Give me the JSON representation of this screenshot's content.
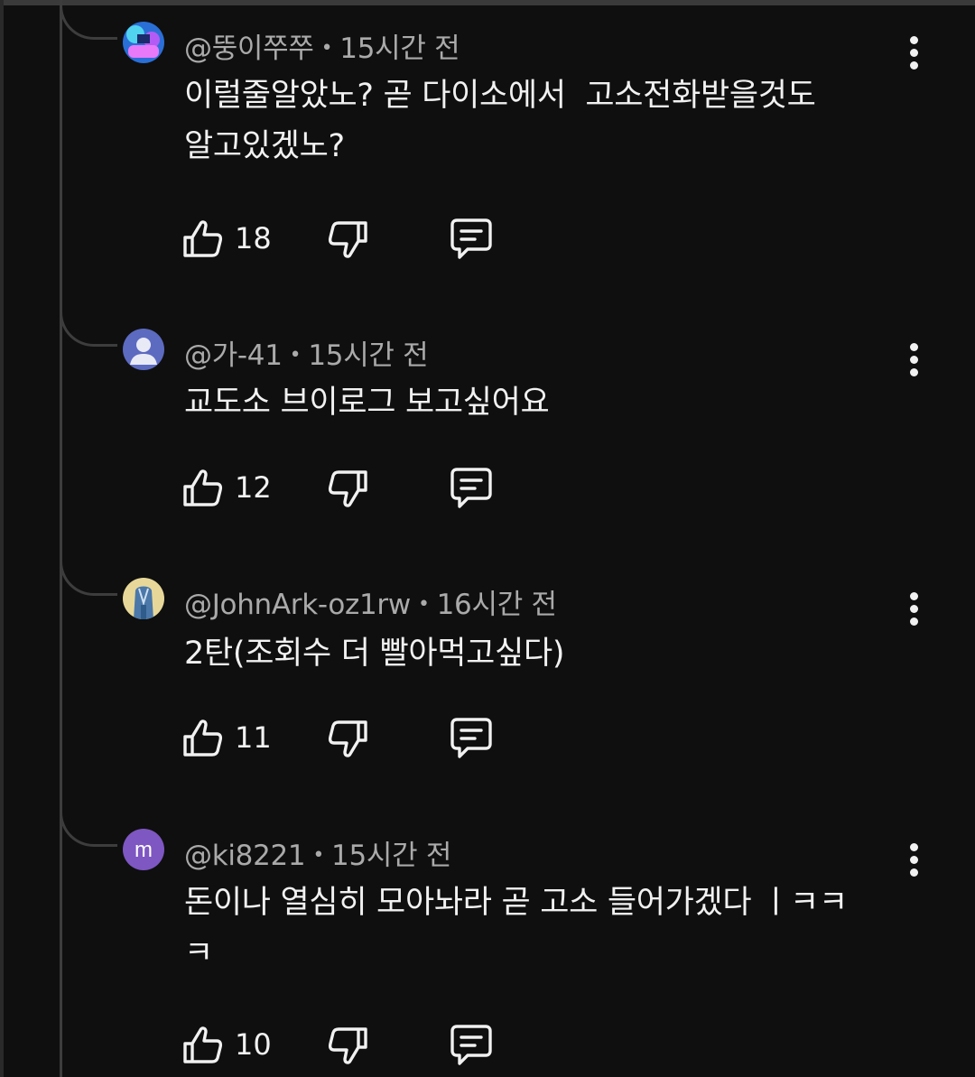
{
  "comments": [
    {
      "author": "@뚱이쭈쭈",
      "time": "15시간 전",
      "text": "이럴줄알았노? 곧 다이소에서  고소전화받을것도\n알고있겠노?",
      "likes": "18",
      "avatar": "image-avatar"
    },
    {
      "author": "@가-41",
      "time": "15시간 전",
      "text": "교도소 브이로그 보고싶어요",
      "likes": "12",
      "avatar": "default-user-avatar"
    },
    {
      "author": "@JohnArk-oz1rw",
      "time": "16시간 전",
      "text": "2탄(조회수 더 빨아먹고싶다)",
      "likes": "11",
      "avatar": "image-avatar"
    },
    {
      "author": "@ki8221",
      "time": "15시간 전",
      "text": "돈이나 열심히 모아놔라 곧 고소 들어가겠다 ㅣㅋㅋ\nㅋ",
      "likes": "10",
      "avatar_letter": "m"
    }
  ],
  "meta_separator": "•",
  "icons": [
    "thumbs-up-icon",
    "thumbs-down-icon",
    "reply-icon",
    "more-vert-icon"
  ],
  "colors": {
    "background": "#0f0f0f",
    "primary_text": "#f1f1f1",
    "secondary_text": "#aaaaaa",
    "thread_line": "#3d3d3d",
    "letter_avatar": "#7e57c2",
    "default_avatar": "#5c6bc0"
  }
}
